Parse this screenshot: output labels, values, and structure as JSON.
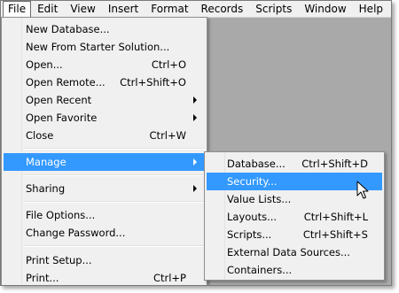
{
  "menubar": {
    "items": [
      "File",
      "Edit",
      "View",
      "Insert",
      "Format",
      "Records",
      "Scripts",
      "Window",
      "Help"
    ]
  },
  "file_menu": {
    "items": [
      {
        "label": "New Database...",
        "shortcut": ""
      },
      {
        "label": "New From Starter Solution...",
        "shortcut": ""
      },
      {
        "label": "Open...",
        "shortcut": "Ctrl+O"
      },
      {
        "label": "Open Remote...",
        "shortcut": "Ctrl+Shift+O"
      },
      {
        "label": "Open Recent",
        "shortcut": ""
      },
      {
        "label": "Open Favorite",
        "shortcut": ""
      },
      {
        "label": "Close",
        "shortcut": "Ctrl+W"
      },
      {
        "label": "Manage",
        "shortcut": ""
      },
      {
        "label": "Sharing",
        "shortcut": ""
      },
      {
        "label": "File Options...",
        "shortcut": ""
      },
      {
        "label": "Change Password...",
        "shortcut": ""
      },
      {
        "label": "Print Setup...",
        "shortcut": ""
      },
      {
        "label": "Print...",
        "shortcut": "Ctrl+P"
      }
    ]
  },
  "manage_menu": {
    "items": [
      {
        "label": "Database...",
        "shortcut": "Ctrl+Shift+D"
      },
      {
        "label": "Security...",
        "shortcut": ""
      },
      {
        "label": "Value Lists...",
        "shortcut": ""
      },
      {
        "label": "Layouts...",
        "shortcut": "Ctrl+Shift+L"
      },
      {
        "label": "Scripts...",
        "shortcut": "Ctrl+Shift+S"
      },
      {
        "label": "External Data Sources...",
        "shortcut": ""
      },
      {
        "label": "Containers...",
        "shortcut": ""
      }
    ]
  },
  "colors": {
    "highlight": "#3399ff",
    "menu_background": "#f0f0f0",
    "workspace": "#a9a9a9"
  }
}
